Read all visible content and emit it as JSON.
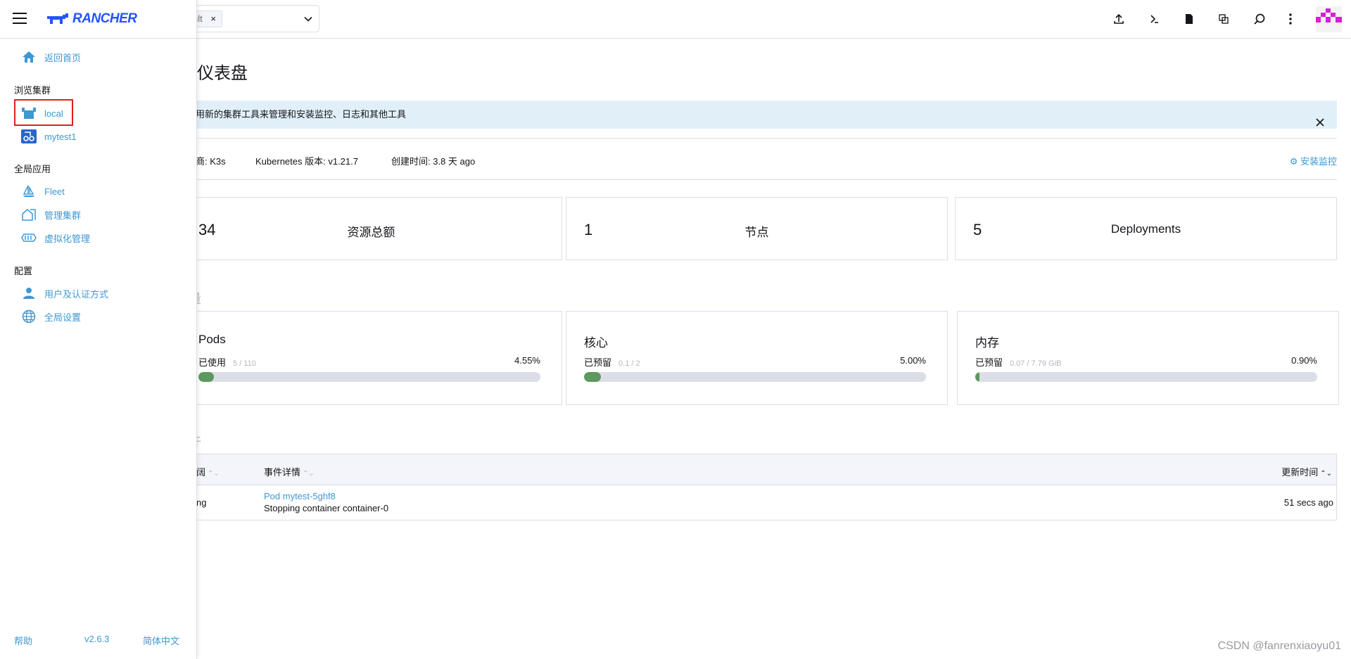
{
  "header": {
    "namespace_chip": "ult",
    "chip_remove": "×"
  },
  "sidebar": {
    "logo": "RANCHER",
    "home": "返回首页",
    "groups": {
      "explore": "浏览集群",
      "global_apps": "全局应用",
      "config": "配置"
    },
    "clusters": [
      "local",
      "mytest1"
    ],
    "apps": [
      "Fleet",
      "管理集群",
      "虚拟化管理"
    ],
    "config_items": [
      "用户及认证方式",
      "全局设置"
    ],
    "footer": {
      "help": "帮助",
      "version": "v2.6.3",
      "language": "简体中文"
    }
  },
  "main": {
    "title": "群仪表盘",
    "banner": "用新的集群工具来管理和安装监控、日志和其他工具",
    "banner_close": "×",
    "info": {
      "provider_label": "商:",
      "provider_value": "K3s",
      "k8s_label": "Kubernetes 版本:",
      "k8s_value": "v1.21.7",
      "created_label": "创建时间:",
      "created_value": "3.8 天 ago"
    },
    "install_monitoring": "安装监控",
    "counts": [
      {
        "value": "34",
        "label": "资源总额"
      },
      {
        "value": "1",
        "label": "节点"
      },
      {
        "value": "5",
        "label": "Deployments"
      }
    ],
    "capacity_title": "量",
    "gauges": [
      {
        "title": "Pods",
        "used_label": "已使用",
        "used_detail": "5 / 110",
        "percent": "4.55%",
        "fraction": 0.0455
      },
      {
        "title": "核心",
        "used_label": "已预留",
        "used_detail": "0.1 / 2",
        "percent": "5.00%",
        "fraction": 0.05
      },
      {
        "title": "内存",
        "used_label": "已预留",
        "used_detail": "0.07 / 7.79 GiB",
        "percent": "0.90%",
        "fraction": 0.009
      }
    ],
    "events_title": "件",
    "table": {
      "col1": "阔",
      "col2": "事件详情",
      "col3": "更新时间",
      "sort_glyph": "⌃⌄",
      "rows": [
        {
          "reason": "ng",
          "object": "Pod mytest-5ghf8",
          "message": "Stopping container container-0",
          "updated": "51 secs ago"
        }
      ]
    },
    "watermark": "CSDN @fanrenxiaoyu01"
  },
  "colors": {
    "accent": "#3d98d3",
    "logo": "#2453ff",
    "bar_fill": "#5d995d",
    "highlight_box": "#e02020",
    "avatar": "#d61fd6"
  }
}
